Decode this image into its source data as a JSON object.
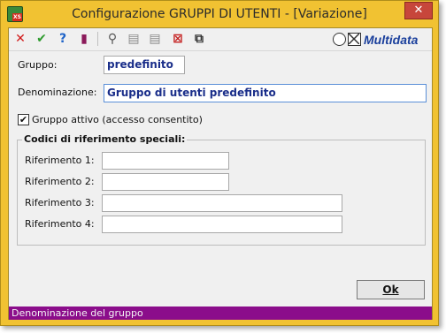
{
  "window": {
    "title": "Configurazione GRUPPI DI UTENTI - [Variazione]",
    "app_icon_badge": "XS",
    "close_glyph": "✕"
  },
  "toolbar": {
    "buttons": [
      {
        "name": "cancel-icon",
        "glyph": "✕",
        "color": "#d21a1a"
      },
      {
        "name": "confirm-icon",
        "glyph": "✔",
        "color": "#2e9b2e"
      },
      {
        "name": "help-icon",
        "glyph": "?",
        "color": "#1e63c8"
      },
      {
        "name": "book-icon",
        "glyph": "▮",
        "color": "#8b1a5a"
      },
      {
        "name": "binoculars-icon",
        "glyph": "⚲",
        "color": "#555555"
      },
      {
        "name": "document-prev-icon",
        "glyph": "▤",
        "color": "#8a8a8a"
      },
      {
        "name": "document-next-icon",
        "glyph": "▤",
        "color": "#8a8a8a"
      },
      {
        "name": "delete-record-icon",
        "glyph": "⊠",
        "color": "#c42020"
      },
      {
        "name": "copy-icon",
        "glyph": "⧉",
        "color": "#333333"
      }
    ],
    "brand": "Multidata"
  },
  "form": {
    "gruppo_label": "Gruppo:",
    "gruppo_value": "predefinito",
    "denominazione_label": "Denominazione:",
    "denominazione_value": "Gruppo di utenti predefinito",
    "attivo_checked": "✔",
    "attivo_label": "Gruppo attivo (accesso consentito)",
    "codici_title": "Codici di riferimento speciali:",
    "riferimenti": [
      {
        "label": "Riferimento 1:",
        "value": ""
      },
      {
        "label": "Riferimento 2:",
        "value": ""
      },
      {
        "label": "Riferimento 3:",
        "value": ""
      },
      {
        "label": "Riferimento 4:",
        "value": ""
      }
    ]
  },
  "ok_button": "Ok",
  "status": "Denominazione del gruppo",
  "colors": {
    "frame": "#f1c232",
    "status_bar": "#8b0d8b",
    "field_text": "#1a2e8a"
  }
}
